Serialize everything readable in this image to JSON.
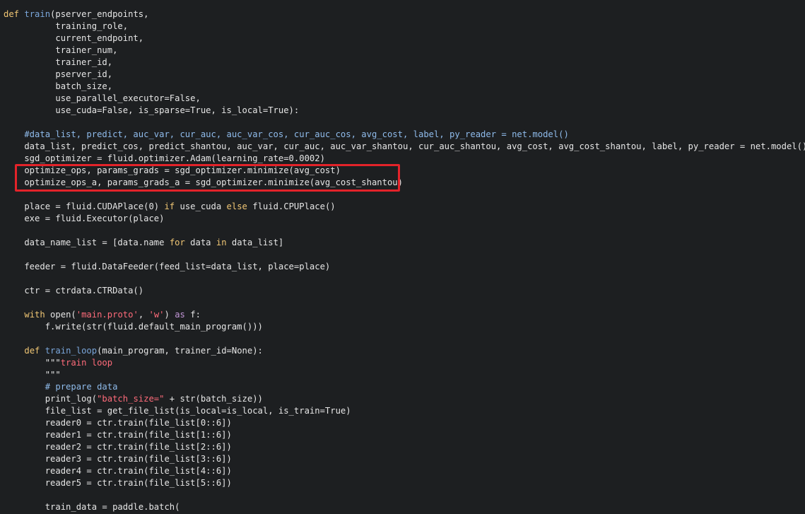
{
  "colors": {
    "background": "#1d1f21",
    "default_text": "#e6e6e6",
    "keyword": "#f0c674",
    "keyword_purple": "#c397d8",
    "function_name": "#7aa6da",
    "string": "#ff6b7a",
    "comment": "#8fbbeb",
    "highlight_box": "#e3232a"
  },
  "code_lines": [
    [
      {
        "t": "def ",
        "c": "kw"
      },
      {
        "t": "train",
        "c": "fn"
      },
      {
        "t": "(pserver_endpoints,",
        "c": "plain"
      }
    ],
    [
      {
        "t": "          training_role,",
        "c": "plain"
      }
    ],
    [
      {
        "t": "          current_endpoint,",
        "c": "plain"
      }
    ],
    [
      {
        "t": "          trainer_num,",
        "c": "plain"
      }
    ],
    [
      {
        "t": "          trainer_id,",
        "c": "plain"
      }
    ],
    [
      {
        "t": "          pserver_id,",
        "c": "plain"
      }
    ],
    [
      {
        "t": "          batch_size,",
        "c": "plain"
      }
    ],
    [
      {
        "t": "          use_parallel_executor=False,",
        "c": "plain"
      }
    ],
    [
      {
        "t": "          use_cuda=False, is_sparse=True, is_local=True):",
        "c": "plain"
      }
    ],
    [
      {
        "t": "",
        "c": "plain"
      }
    ],
    [
      {
        "t": "    #data_list, predict, auc_var, cur_auc, auc_var_cos, cur_auc_cos, avg_cost, label, py_reader = net.model()",
        "c": "comment"
      }
    ],
    [
      {
        "t": "    data_list, predict_cos, predict_shantou, auc_var, cur_auc, auc_var_shantou, cur_auc_shantou, avg_cost, avg_cost_shantou, label, py_reader = net.model()",
        "c": "plain"
      }
    ],
    [
      {
        "t": "    sgd_optimizer = fluid.optimizer.Adam(learning_rate=0.0002)",
        "c": "plain"
      }
    ],
    [
      {
        "t": "    optimize_ops, params_grads = sgd_optimizer.minimize(avg_cost)",
        "c": "plain"
      }
    ],
    [
      {
        "t": "    optimize_ops_a, params_grads_a = sgd_optimizer.minimize(avg_cost_shantou)",
        "c": "plain"
      }
    ],
    [
      {
        "t": "",
        "c": "plain"
      }
    ],
    [
      {
        "t": "    place = fluid.CUDAPlace(0) ",
        "c": "plain"
      },
      {
        "t": "if",
        "c": "kw"
      },
      {
        "t": " use_cuda ",
        "c": "plain"
      },
      {
        "t": "else",
        "c": "kw"
      },
      {
        "t": " fluid.CPUPlace()",
        "c": "plain"
      }
    ],
    [
      {
        "t": "    exe = fluid.Executor(place)",
        "c": "plain"
      }
    ],
    [
      {
        "t": "",
        "c": "plain"
      }
    ],
    [
      {
        "t": "    data_name_list = [data.name ",
        "c": "plain"
      },
      {
        "t": "for",
        "c": "kw"
      },
      {
        "t": " data ",
        "c": "plain"
      },
      {
        "t": "in",
        "c": "kw"
      },
      {
        "t": " data_list]",
        "c": "plain"
      }
    ],
    [
      {
        "t": "",
        "c": "plain"
      }
    ],
    [
      {
        "t": "    feeder = fluid.DataFeeder(feed_list=data_list, place=place)",
        "c": "plain"
      }
    ],
    [
      {
        "t": "",
        "c": "plain"
      }
    ],
    [
      {
        "t": "    ctr = ctrdata.CTRData()",
        "c": "plain"
      }
    ],
    [
      {
        "t": "",
        "c": "plain"
      }
    ],
    [
      {
        "t": "    ",
        "c": "plain"
      },
      {
        "t": "with",
        "c": "kw"
      },
      {
        "t": " open(",
        "c": "plain"
      },
      {
        "t": "'main.proto'",
        "c": "str"
      },
      {
        "t": ", ",
        "c": "plain"
      },
      {
        "t": "'w'",
        "c": "str"
      },
      {
        "t": ") ",
        "c": "plain"
      },
      {
        "t": "as",
        "c": "kw2"
      },
      {
        "t": " f:",
        "c": "plain"
      }
    ],
    [
      {
        "t": "        f.write(str(fluid.default_main_program()))",
        "c": "plain"
      }
    ],
    [
      {
        "t": "",
        "c": "plain"
      }
    ],
    [
      {
        "t": "    ",
        "c": "plain"
      },
      {
        "t": "def ",
        "c": "kw"
      },
      {
        "t": "train_loop",
        "c": "fn"
      },
      {
        "t": "(main_program, trainer_id=None):",
        "c": "plain"
      }
    ],
    [
      {
        "t": "        \"\"\"",
        "c": "plain"
      },
      {
        "t": "train loop",
        "c": "str"
      }
    ],
    [
      {
        "t": "        \"\"\"",
        "c": "plain"
      }
    ],
    [
      {
        "t": "        # prepare data",
        "c": "comment"
      }
    ],
    [
      {
        "t": "        print_log(",
        "c": "plain"
      },
      {
        "t": "\"batch_size=\"",
        "c": "str"
      },
      {
        "t": " + str(batch_size))",
        "c": "plain"
      }
    ],
    [
      {
        "t": "        file_list = get_file_list(is_local=is_local, is_train=True)",
        "c": "plain"
      }
    ],
    [
      {
        "t": "        reader0 = ctr.train(file_list[0::6])",
        "c": "plain"
      }
    ],
    [
      {
        "t": "        reader1 = ctr.train(file_list[1::6])",
        "c": "plain"
      }
    ],
    [
      {
        "t": "        reader2 = ctr.train(file_list[2::6])",
        "c": "plain"
      }
    ],
    [
      {
        "t": "        reader3 = ctr.train(file_list[3::6])",
        "c": "plain"
      }
    ],
    [
      {
        "t": "        reader4 = ctr.train(file_list[4::6])",
        "c": "plain"
      }
    ],
    [
      {
        "t": "        reader5 = ctr.train(file_list[5::6])",
        "c": "plain"
      }
    ],
    [
      {
        "t": "",
        "c": "plain"
      }
    ],
    [
      {
        "t": "        train_data = paddle.batch(",
        "c": "plain"
      }
    ]
  ]
}
